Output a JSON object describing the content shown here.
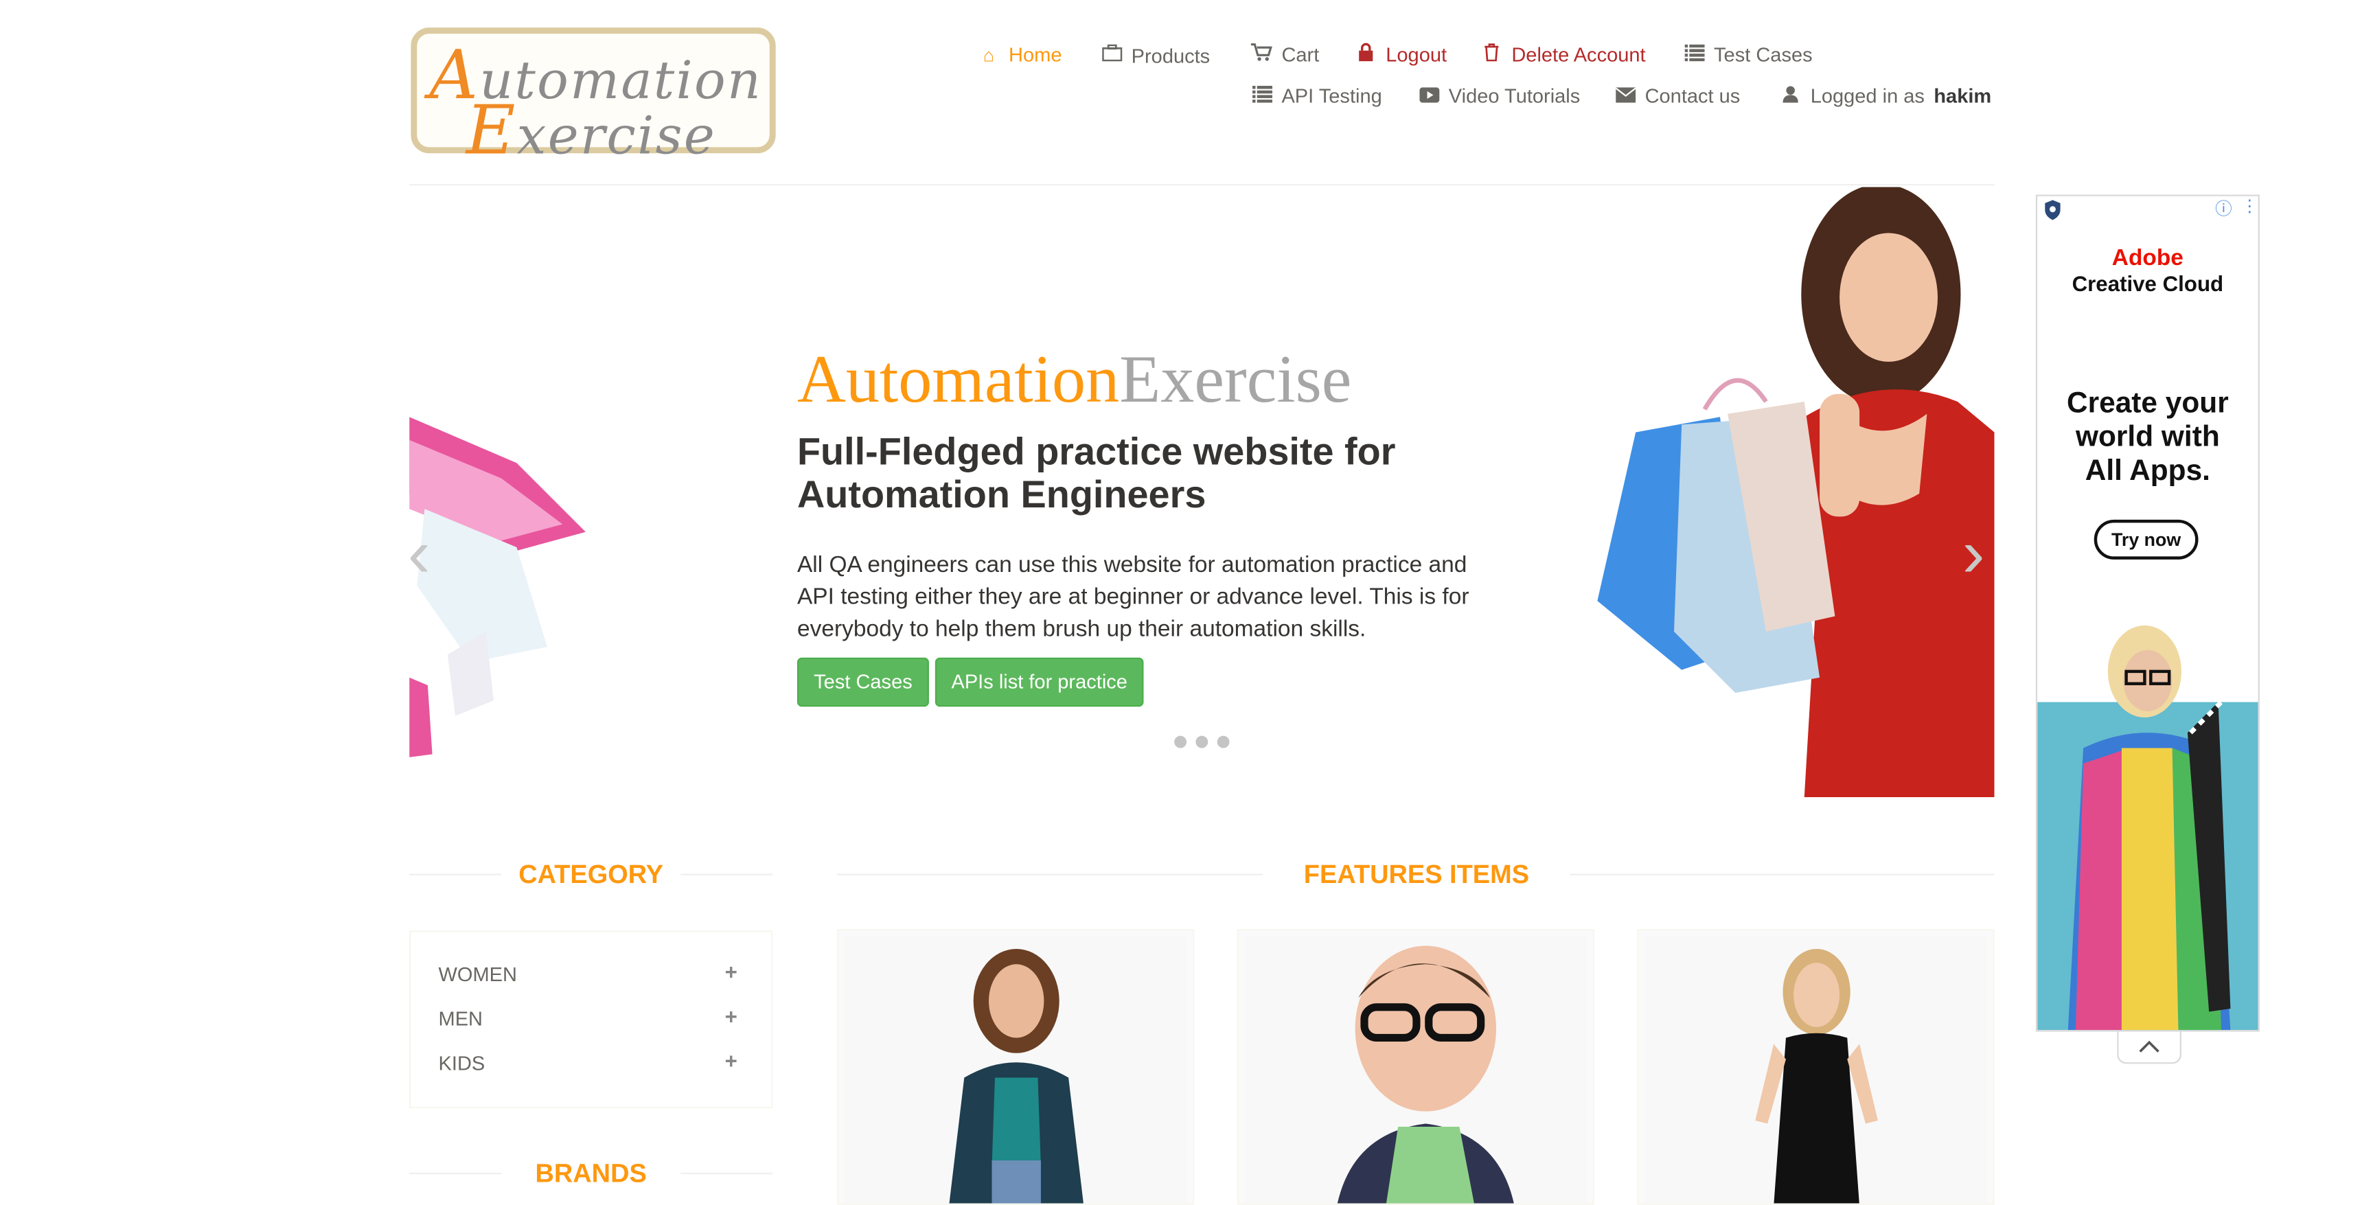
{
  "logo": {
    "line1_first": "A",
    "line1_rest": "utomation",
    "line2_first": "E",
    "line2_rest": "xercise"
  },
  "nav": {
    "home": "Home",
    "products": "Products",
    "cart": "Cart",
    "logout": "Logout",
    "delete_account": "Delete Account",
    "test_cases": "Test Cases",
    "api_testing": "API Testing",
    "video_tutorials": "Video Tutorials",
    "contact_us": "Contact us",
    "logged_in_prefix": "Logged in as",
    "username": "hakim"
  },
  "slider": {
    "brand_a": "Automation",
    "brand_b": "Exercise",
    "headline": "Full-Fledged practice website for Automation Engineers",
    "description": "All QA engineers can use this website for automation practice and API testing either they are at beginner or advance level. This is for everybody to help them brush up their automation skills.",
    "btn_test_cases": "Test Cases",
    "btn_apis": "APIs list for practice"
  },
  "category": {
    "title": "CATEGORY",
    "items": [
      {
        "label": "WOMEN",
        "toggle": "+"
      },
      {
        "label": "MEN",
        "toggle": "+"
      },
      {
        "label": "KIDS",
        "toggle": "+"
      }
    ]
  },
  "brands": {
    "title": "BRANDS"
  },
  "features": {
    "title": "FEATURES ITEMS"
  },
  "ad": {
    "brand_line1": "Adobe",
    "brand_line2": "Creative Cloud",
    "headline_1": "Create your",
    "headline_2": "world with",
    "headline_3": "All Apps.",
    "cta": "Try now",
    "info_glyph": "ⓘ",
    "menu_glyph": "⋮"
  },
  "colors": {
    "accent": "#fe980f",
    "danger": "#b52a2a",
    "green": "#5cb85c",
    "text": "#696763",
    "heading": "#363432"
  },
  "icons": {
    "home": "home-icon",
    "products": "briefcase-icon",
    "cart": "cart-icon",
    "logout": "lock-icon",
    "delete": "trash-icon",
    "test_cases": "list-icon",
    "api": "list-icon",
    "video": "video-icon",
    "contact": "envelope-icon",
    "user": "user-icon"
  }
}
